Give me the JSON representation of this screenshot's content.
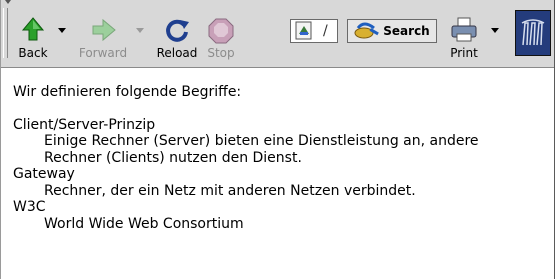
{
  "toolbar": {
    "back_label": "Back",
    "forward_label": "Forward",
    "reload_label": "Reload",
    "stop_label": "Stop",
    "search_label": "Search",
    "print_label": "Print",
    "address_separator": "/"
  },
  "content": {
    "intro": "Wir definieren folgende Begriffe:",
    "terms": [
      {
        "term": "Client/Server-Prinzip",
        "definition": "Einige Rechner (Server) bieten eine Dienstleistung an, andere Rechner (Clients) nutzen den Dienst."
      },
      {
        "term": "Gateway",
        "definition": "Rechner, der ein Netz mit anderen Netzen verbindet."
      },
      {
        "term": "W3C",
        "definition": "World Wide Web Consortium"
      }
    ]
  },
  "colors": {
    "toolbar_bg": "#d8d8d8",
    "back_arrow": "#2aa02a",
    "forward_arrow_disabled": "#9ccf9c",
    "reload_icon": "#1f3f8f",
    "logo_bg": "#243c7c"
  }
}
